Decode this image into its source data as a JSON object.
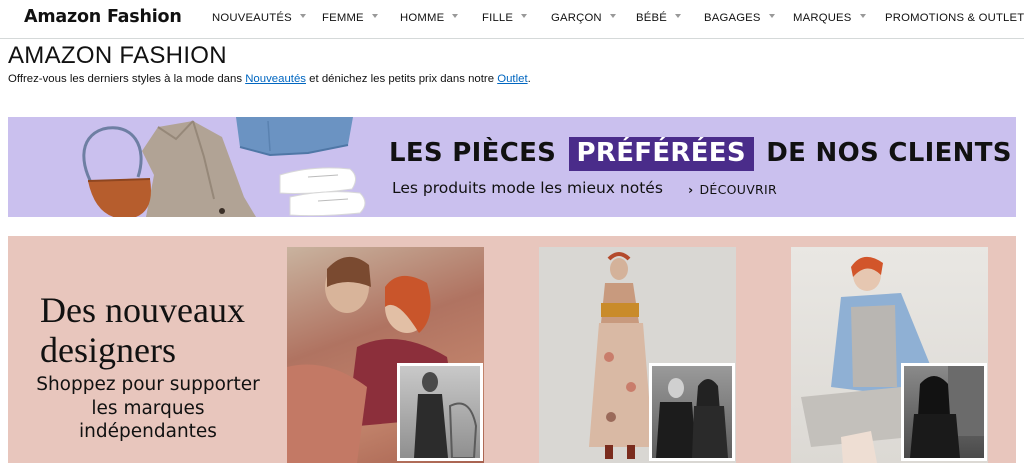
{
  "header": {
    "brand": "Amazon Fashion",
    "nav": [
      {
        "label": "NOUVEAUTÉS"
      },
      {
        "label": "FEMME"
      },
      {
        "label": "HOMME"
      },
      {
        "label": "FILLE"
      },
      {
        "label": "GARÇON"
      },
      {
        "label": "BÉBÉ"
      },
      {
        "label": "BAGAGES"
      },
      {
        "label": "MARQUES"
      },
      {
        "label": "PROMOTIONS & OUTLET"
      }
    ]
  },
  "page": {
    "title": "AMAZON FASHION",
    "subtitle_before": "Offrez-vous les derniers styles à la mode dans ",
    "subtitle_link1": "Nouveautés",
    "subtitle_middle": " et dénichez les petits prix dans notre ",
    "subtitle_link2": "Outlet",
    "subtitle_end": "."
  },
  "banner_clients": {
    "title_before": "LES PIÈCES",
    "title_highlight": "PRÉFÉRÉES",
    "title_after": "DE NOS CLIENTS",
    "subtitle": "Les produits mode les mieux notés",
    "cta": "DÉCOUVRIR"
  },
  "banner_designers": {
    "heading": "Des nouveaux designers",
    "subtitle": "Shoppez pour supporter les marques indépendantes"
  },
  "colors": {
    "banner_clients_bg": "#cac0ee",
    "highlight_bg": "#4a2c8a",
    "banner_designers_bg": "#e8c6bd",
    "link": "#0066c0"
  }
}
